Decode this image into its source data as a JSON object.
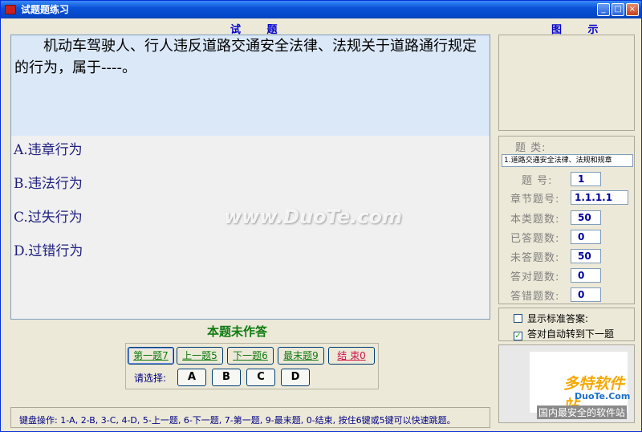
{
  "window": {
    "title": "试题题练习"
  },
  "captions": {
    "question": "试 题",
    "figure": "图 示"
  },
  "question": {
    "text": "机动车驾驶人、行人违反道路交通安全法律、法规关于道路通行规定的行为，属于----。",
    "options": [
      {
        "letter": "A",
        "text": "A.违章行为"
      },
      {
        "letter": "B",
        "text": "B.违法行为"
      },
      {
        "letter": "C",
        "text": "C.过失行为"
      },
      {
        "letter": "D",
        "text": "D.过错行为"
      }
    ]
  },
  "info": {
    "category_label": "题 类:",
    "category_value": "1.道路交通安全法律、法规和规章",
    "rows": [
      {
        "label": "题  号:",
        "value": "1"
      },
      {
        "label": "章节题号:",
        "value": "1.1.1.1"
      },
      {
        "label": "本类题数:",
        "value": "50"
      },
      {
        "label": "已答题数:",
        "value": "0"
      },
      {
        "label": "未答题数:",
        "value": "50"
      },
      {
        "label": "答对题数:",
        "value": "0"
      },
      {
        "label": "答错题数:",
        "value": "0"
      }
    ]
  },
  "checkboxes": {
    "show_answer": {
      "label": "显示标准答案:",
      "checked": false
    },
    "auto_next": {
      "label": "答对自动转到下一题",
      "checked": true
    }
  },
  "status": "本题未作答",
  "nav": {
    "first": "第一题7",
    "prev": "上一题5",
    "next": "下一题6",
    "last": "最末题9",
    "end": "结 束0"
  },
  "choose": {
    "label": "请选择:",
    "buttons": [
      "A",
      "B",
      "C",
      "D"
    ]
  },
  "hint": "键盘操作: 1-A, 2-B, 3-C, 4-D, 5-上一题, 6-下一题, 7-第一题, 9-最末题, 0-结束, 按住6键或5键可以快速跳题。",
  "watermark": "www.DuoTe.com",
  "logo": {
    "text": "多特软件站",
    "sub": "DuoTe.Com",
    "footer": "国内最安全的软件站"
  },
  "colors": {
    "titlebar": "#0a52d8",
    "caption": "#0000cc",
    "status": "#107a10",
    "stem_bg": "#dbe8f8"
  }
}
